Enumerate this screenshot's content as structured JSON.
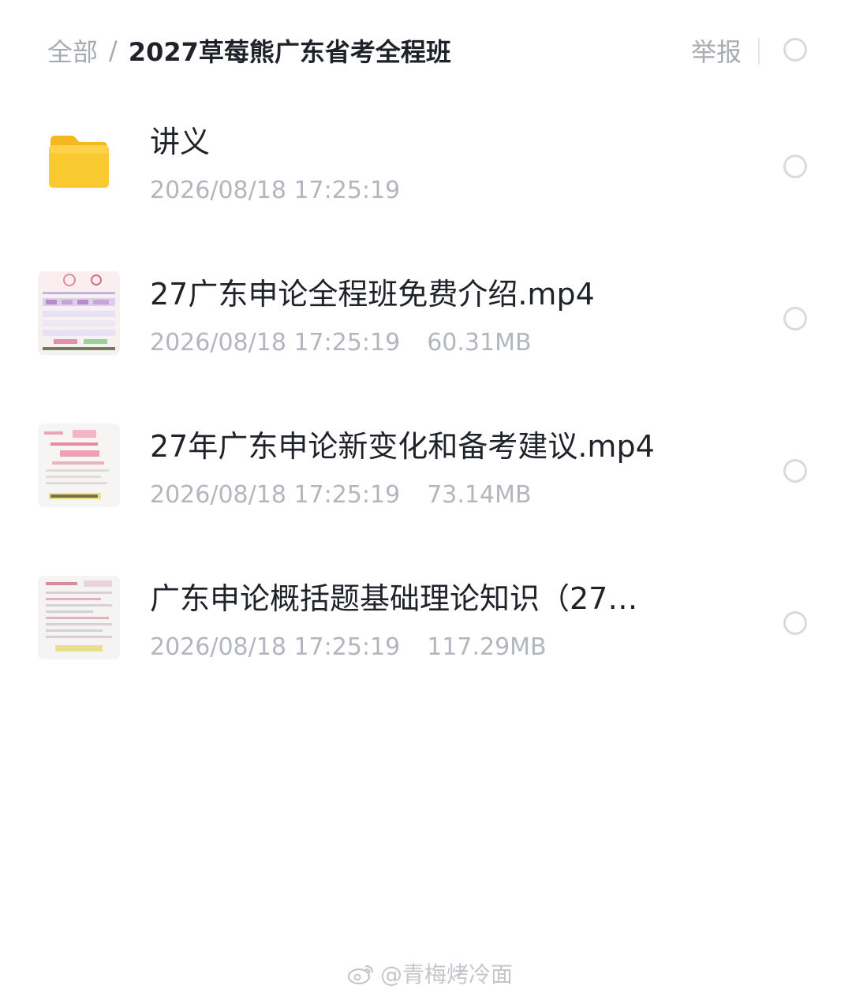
{
  "header": {
    "breadcrumb_root": "全部",
    "breadcrumb_separator": "/",
    "breadcrumb_current": "2027草莓熊广东省考全程班",
    "report_label": "举报"
  },
  "files": [
    {
      "name": "讲义",
      "type_icon": "folder-icon",
      "date": "2026/08/18 17:25:19",
      "size": ""
    },
    {
      "name": "27广东申论全程班免费介绍.mp4",
      "type_icon": "video-thumbnail",
      "date": "2026/08/18 17:25:19",
      "size": "60.31MB"
    },
    {
      "name": "27年广东申论新变化和备考建议.mp4",
      "type_icon": "video-thumbnail",
      "date": "2026/08/18 17:25:19",
      "size": "73.14MB"
    },
    {
      "name": "广东申论概括题基础理论知识（27…",
      "type_icon": "video-thumbnail",
      "date": "2026/08/18 17:25:19",
      "size": "117.29MB"
    }
  ],
  "watermark": {
    "text": "@青梅烤冷面"
  },
  "colors": {
    "text_primary": "#1f2329",
    "text_secondary": "#b3b6bd",
    "folder": "#f7c630",
    "radio_border": "#d8dadf"
  }
}
